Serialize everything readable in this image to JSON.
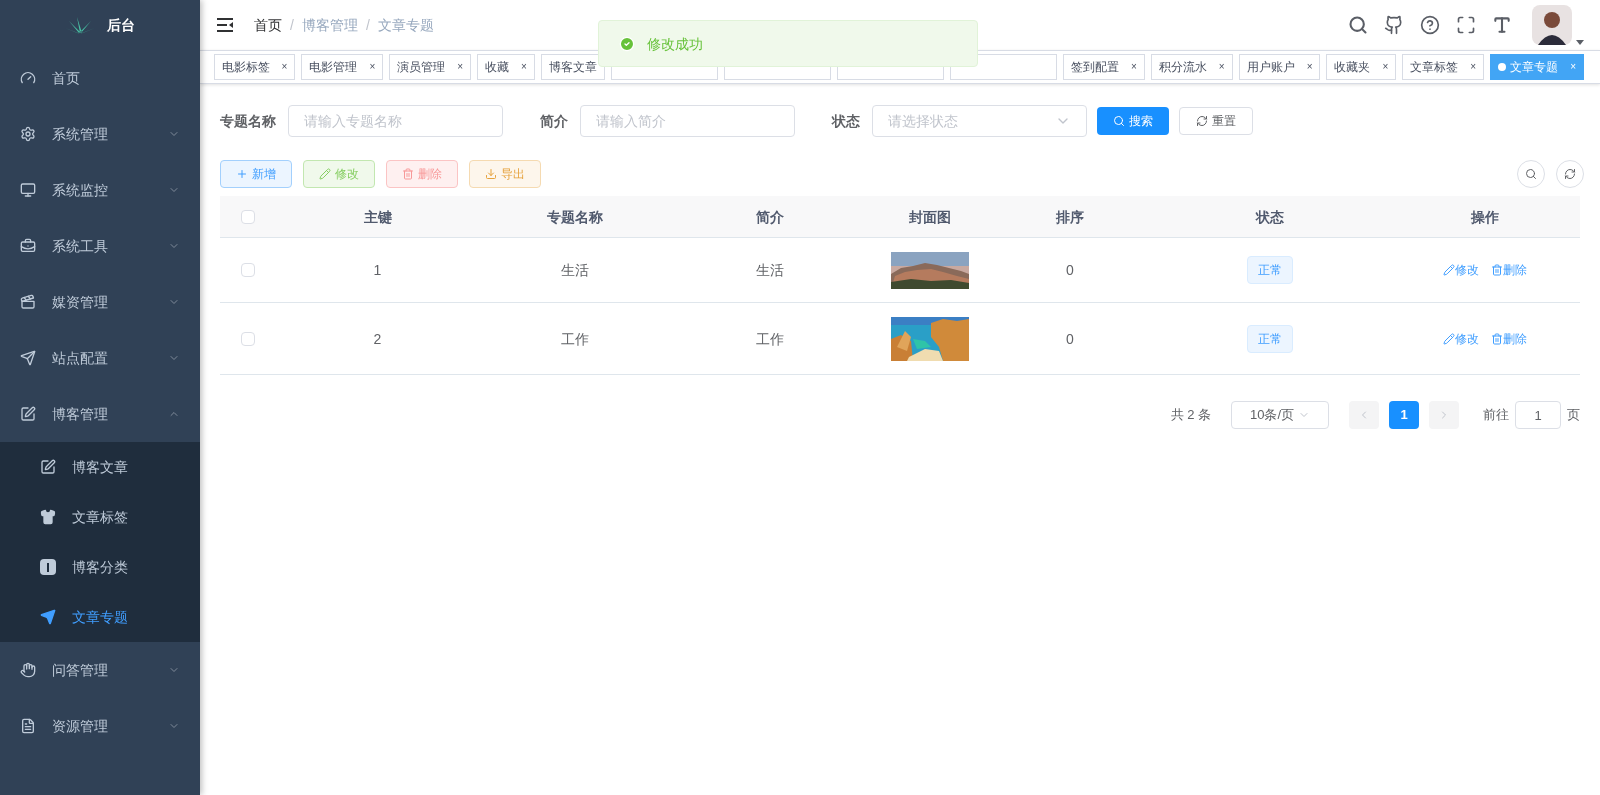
{
  "sidebar": {
    "logo": "后台",
    "items": [
      {
        "kind": "link",
        "label": "首页"
      },
      {
        "kind": "group",
        "label": "系统管理",
        "expanded": false
      },
      {
        "kind": "group",
        "label": "系统监控",
        "expanded": false
      },
      {
        "kind": "group",
        "label": "系统工具",
        "expanded": false
      },
      {
        "kind": "group",
        "label": "媒资管理",
        "expanded": false
      },
      {
        "kind": "group",
        "label": "站点配置",
        "expanded": false
      },
      {
        "kind": "group",
        "label": "博客管理",
        "expanded": true,
        "children": [
          {
            "label": "博客文章",
            "selected": false
          },
          {
            "label": "文章标签",
            "selected": false
          },
          {
            "label": "博客分类",
            "selected": false
          },
          {
            "label": "文章专题",
            "selected": true
          }
        ]
      },
      {
        "kind": "group",
        "label": "问答管理",
        "expanded": false
      },
      {
        "kind": "group",
        "label": "资源管理",
        "expanded": false
      }
    ]
  },
  "breadcrumb": [
    "首页",
    "博客管理",
    "文章专题"
  ],
  "breadcrumb_separator": "/",
  "toast": {
    "message": "修改成功"
  },
  "tags": [
    {
      "label": "电影标签",
      "close": "×",
      "selected": false
    },
    {
      "label": "电影管理",
      "close": "×",
      "selected": false
    },
    {
      "label": "演员管理",
      "close": "×",
      "selected": false
    },
    {
      "label": "收藏",
      "close": "×",
      "selected": false
    },
    {
      "label": "博客文章",
      "selected": false
    },
    {
      "selected": false
    },
    {
      "selected": false
    },
    {
      "selected": false
    },
    {
      "selected": false
    },
    {
      "label": "签到配置",
      "close": "×",
      "selected": false
    },
    {
      "label": "积分流水",
      "close": "×",
      "selected": false
    },
    {
      "label": "用户账户",
      "close": "×",
      "selected": false
    },
    {
      "label": "收藏夹",
      "close": "×",
      "selected": false
    },
    {
      "label": "文章标签",
      "close": "×",
      "selected": false
    },
    {
      "label": "文章专题",
      "close": "×",
      "selected": true
    }
  ],
  "filters": [
    {
      "kind": "input",
      "label": "专题名称",
      "placeholder": "请输入专题名称"
    },
    {
      "kind": "input",
      "label": "简介",
      "placeholder": "请输入简介"
    },
    {
      "kind": "select",
      "label": "状态",
      "placeholder": "请选择状态"
    }
  ],
  "search_button": "搜索",
  "reset_button": "重置",
  "actions": [
    {
      "kind": "add",
      "label": "新增"
    },
    {
      "kind": "edit",
      "label": "修改"
    },
    {
      "kind": "delete",
      "label": "删除"
    },
    {
      "kind": "export",
      "label": "导出"
    }
  ],
  "table": {
    "select_all_checked": false,
    "columns": [
      "主键",
      "专题名称",
      "简介",
      "封面图",
      "排序",
      "状态",
      "操作"
    ],
    "rows": [
      {
        "checked": false,
        "id": "1",
        "name": "生活",
        "intro": "生活",
        "sort": "0",
        "status": "正常",
        "edit": "修改",
        "delete": "删除"
      },
      {
        "checked": false,
        "id": "2",
        "name": "工作",
        "intro": "工作",
        "sort": "0",
        "status": "正常",
        "edit": "修改",
        "delete": "删除"
      }
    ]
  },
  "pagination": {
    "total": "共 2 条",
    "page_size": "10条/页",
    "pages": [
      {
        "label": "1",
        "selected": true
      }
    ],
    "goto_label": "前往",
    "goto_value": "1",
    "goto_suffix": "页"
  }
}
